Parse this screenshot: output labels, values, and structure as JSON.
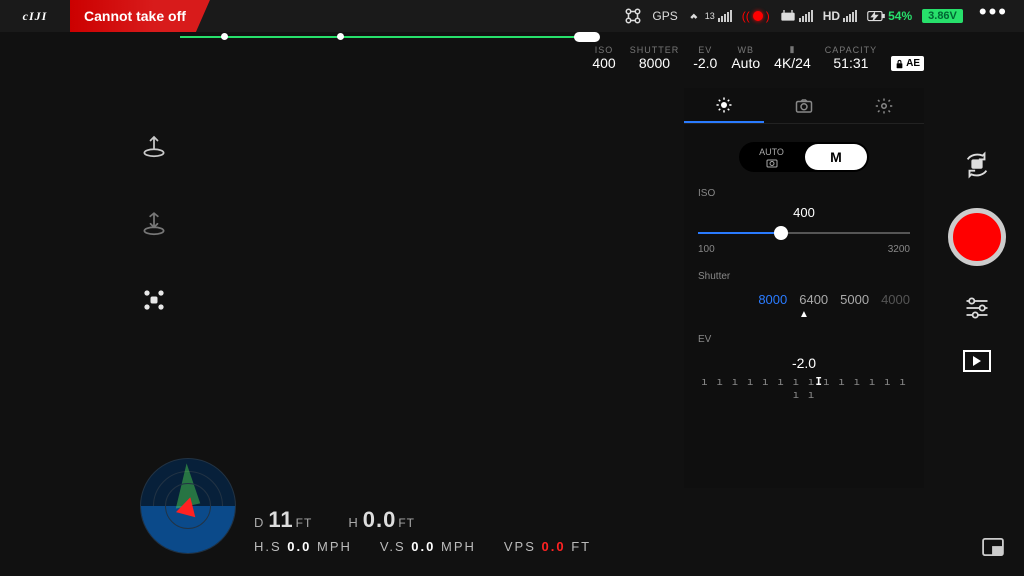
{
  "topbar": {
    "brand": "cIJI",
    "alert": "Cannot take off",
    "gps_label": "GPS",
    "sat_count": "13",
    "hd_label": "HD",
    "battery_pct": "54%",
    "battery_v": "3.86V"
  },
  "caminfo": {
    "iso_label": "ISO",
    "iso": "400",
    "shutter_label": "SHUTTER",
    "shutter": "8000",
    "ev_label": "EV",
    "ev": "-2.0",
    "wb_label": "WB",
    "wb": "Auto",
    "fmt_label": "",
    "fmt": "4K/24",
    "cap_label": "CAPACITY",
    "cap": "51:31",
    "ae_lock": "AE"
  },
  "panel": {
    "mode_auto": "AUTO",
    "mode_m": "M",
    "iso_label": "ISO",
    "iso_value": "400",
    "iso_min": "100",
    "iso_max": "3200",
    "shutter_label": "Shutter",
    "shutter_options": [
      "8000",
      "6400",
      "5000",
      "4000"
    ],
    "ev_label": "EV",
    "ev_value": "-2.0"
  },
  "telemetry": {
    "d_label": "D",
    "d_val": "11",
    "d_unit": "FT",
    "h_label": "H",
    "h_val": "0.0",
    "h_unit": "FT",
    "hs_label": "H.S",
    "hs_val": "0.0",
    "hs_unit": "MPH",
    "vs_label": "V.S",
    "vs_val": "0.0",
    "vs_unit": "MPH",
    "vps_label": "VPS",
    "vps_val": "0.0",
    "vps_unit": "FT"
  }
}
